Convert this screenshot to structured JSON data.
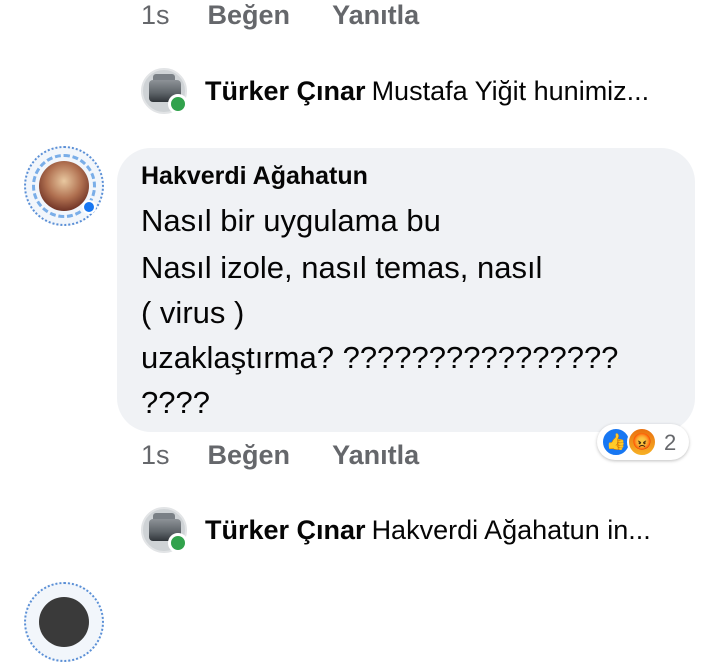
{
  "top_actions": {
    "time": "1s",
    "like": "Beğen",
    "reply": "Yanıtla"
  },
  "reply_1": {
    "name": "Türker Çınar",
    "snippet": "Mustafa Yiğit hunimiz..."
  },
  "comment": {
    "author": "Hakverdi Ağahatun",
    "lines": [
      "Nasıl bir uygulama bu",
      "Nasıl izole, nasıl temas, nasıl",
      "( virus )",
      "uzaklaştırma? ????????????????",
      "????"
    ],
    "reactions": {
      "like_icon": "like-icon",
      "angry_icon": "angry-icon",
      "count": "2"
    }
  },
  "comment_actions": {
    "time": "1s",
    "like": "Beğen",
    "reply": "Yanıtla"
  },
  "reply_2": {
    "name": "Türker Çınar",
    "snippet": "Hakverdi Ağahatun in..."
  },
  "colors": {
    "bubble": "#f0f2f5",
    "secondary_text": "#65676b",
    "online": "#31a24c",
    "like_blue": "#1877f2"
  }
}
